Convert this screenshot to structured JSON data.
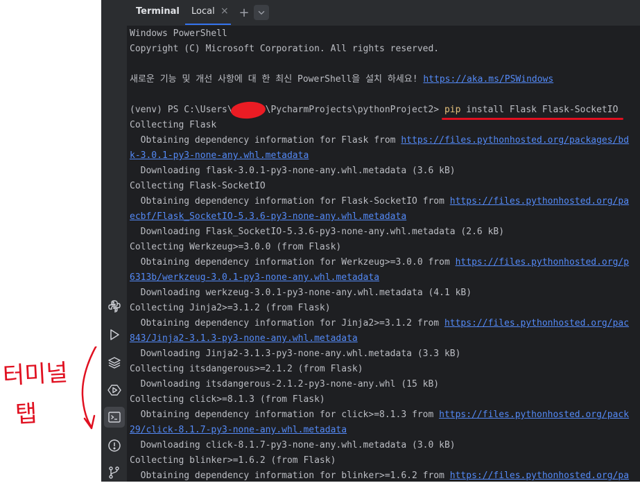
{
  "header": {
    "title": "Terminal",
    "tab": {
      "label": "Local",
      "close": "×"
    },
    "new_tab": "+",
    "dropdown": "⌄"
  },
  "stripe": {
    "icons": [
      "python-console-icon",
      "run-icon",
      "layers-icon",
      "services-icon",
      "terminal-icon",
      "problems-icon",
      "git-icon"
    ],
    "active": "terminal-icon"
  },
  "terminal": {
    "lines": [
      [
        {
          "t": "Windows PowerShell"
        }
      ],
      [
        {
          "t": "Copyright (C) Microsoft Corporation. All rights reserved."
        }
      ],
      [
        {
          "t": ""
        }
      ],
      [
        {
          "t": "새로운 기능 및 개선 사항에 대 한 최신 PowerShell을 설치 하세요! "
        },
        {
          "t": "https://aka.ms/PSWindows",
          "c": "link"
        }
      ],
      [
        {
          "t": ""
        }
      ],
      [
        {
          "t": "(venv) PS C:\\Users\\      \\PycharmProjects\\pythonProject2> "
        },
        {
          "t": "pip",
          "c": "kw"
        },
        {
          "t": " install Flask Flask-SocketIO",
          "c": "cmd"
        }
      ],
      [
        {
          "t": "Collecting Flask"
        }
      ],
      [
        {
          "t": "  Obtaining dependency information for Flask from "
        },
        {
          "t": "https://files.pythonhosted.org/packages/bd",
          "c": "link"
        }
      ],
      [
        {
          "t": "k-3.0.1-py3-none-any.whl.metadata",
          "c": "link"
        }
      ],
      [
        {
          "t": "  Downloading flask-3.0.1-py3-none-any.whl.metadata (3.6 kB)"
        }
      ],
      [
        {
          "t": "Collecting Flask-SocketIO"
        }
      ],
      [
        {
          "t": "  Obtaining dependency information for Flask-SocketIO from "
        },
        {
          "t": "https://files.pythonhosted.org/pa",
          "c": "link"
        }
      ],
      [
        {
          "t": "ecbf/Flask_SocketIO-5.3.6-py3-none-any.whl.metadata",
          "c": "link"
        }
      ],
      [
        {
          "t": "  Downloading Flask_SocketIO-5.3.6-py3-none-any.whl.metadata (2.6 kB)"
        }
      ],
      [
        {
          "t": "Collecting Werkzeug>=3.0.0 (from Flask)"
        }
      ],
      [
        {
          "t": "  Obtaining dependency information for Werkzeug>=3.0.0 from "
        },
        {
          "t": "https://files.pythonhosted.org/p",
          "c": "link"
        }
      ],
      [
        {
          "t": "6313b/werkzeug-3.0.1-py3-none-any.whl.metadata",
          "c": "link"
        }
      ],
      [
        {
          "t": "  Downloading werkzeug-3.0.1-py3-none-any.whl.metadata (4.1 kB)"
        }
      ],
      [
        {
          "t": "Collecting Jinja2>=3.1.2 (from Flask)"
        }
      ],
      [
        {
          "t": "  Obtaining dependency information for Jinja2>=3.1.2 from "
        },
        {
          "t": "https://files.pythonhosted.org/pac",
          "c": "link"
        }
      ],
      [
        {
          "t": "843/Jinja2-3.1.3-py3-none-any.whl.metadata",
          "c": "link"
        }
      ],
      [
        {
          "t": "  Downloading Jinja2-3.1.3-py3-none-any.whl.metadata (3.3 kB)"
        }
      ],
      [
        {
          "t": "Collecting itsdangerous>=2.1.2 (from Flask)"
        }
      ],
      [
        {
          "t": "  Downloading itsdangerous-2.1.2-py3-none-any.whl (15 kB)"
        }
      ],
      [
        {
          "t": "Collecting click>=8.1.3 (from Flask)"
        }
      ],
      [
        {
          "t": "  Obtaining dependency information for click>=8.1.3 from "
        },
        {
          "t": "https://files.pythonhosted.org/pack",
          "c": "link"
        }
      ],
      [
        {
          "t": "29/click-8.1.7-py3-none-any.whl.metadata",
          "c": "link"
        }
      ],
      [
        {
          "t": "  Downloading click-8.1.7-py3-none-any.whl.metadata (3.0 kB)"
        }
      ],
      [
        {
          "t": "Collecting blinker>=1.6.2 (from Flask)"
        }
      ],
      [
        {
          "t": "  Obtaining dependency information for blinker>=1.6.2 from "
        },
        {
          "t": "https://files.pythonhosted.org/pa",
          "c": "link"
        }
      ]
    ]
  },
  "annotation": {
    "text": "터미널 탭",
    "color": "#e01020"
  },
  "colors": {
    "background": "#1e1f22",
    "toolbar": "#2b2d30",
    "text": "#bcbec4",
    "link": "#548af7",
    "command": "#e5c07b",
    "accent": "#3574f0"
  }
}
